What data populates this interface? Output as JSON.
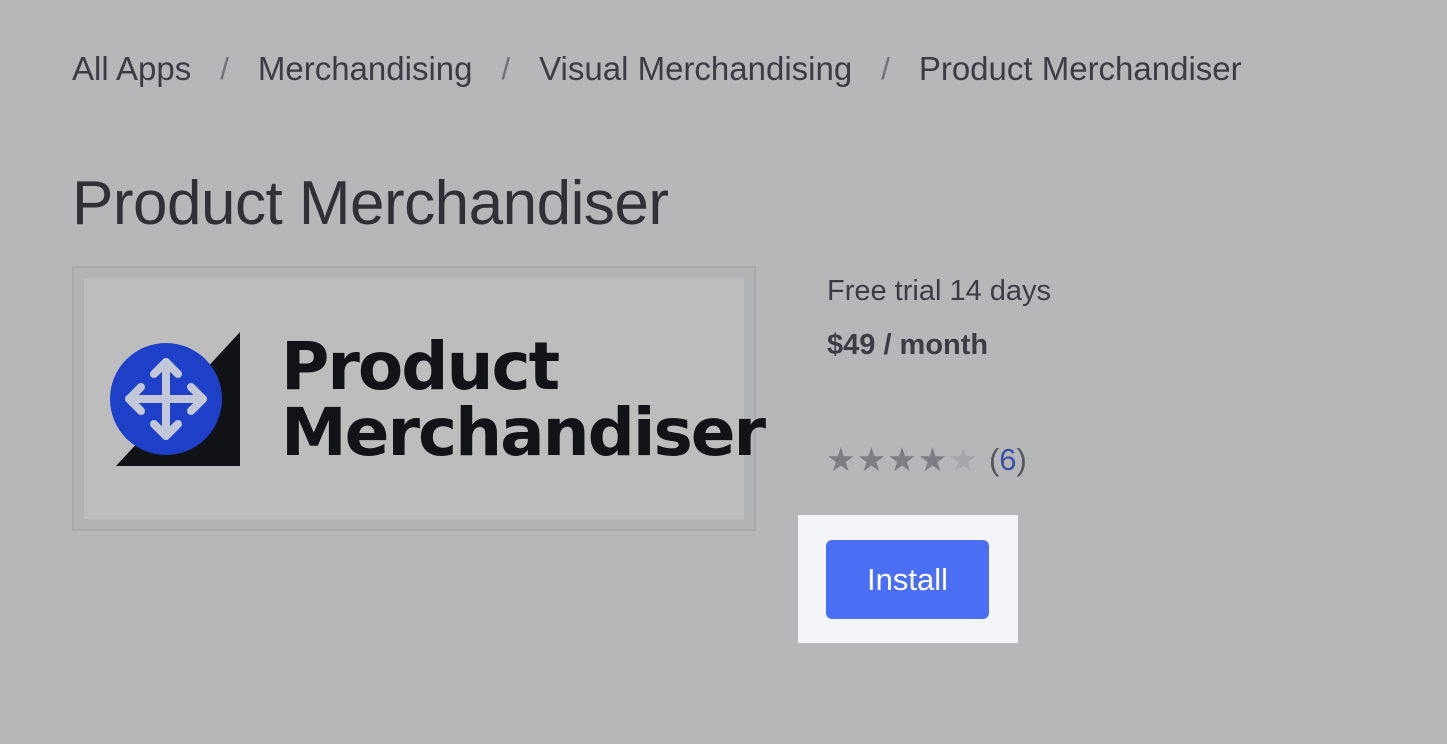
{
  "breadcrumb": {
    "items": [
      "All Apps",
      "Merchandising",
      "Visual Merchandising",
      "Product Merchandiser"
    ],
    "separator": "/"
  },
  "page_title": "Product Merchandiser",
  "logo": {
    "line1": "Product",
    "line2": "Merchandiser",
    "icon": "move-arrows-icon",
    "icon_color": "#1e40c8"
  },
  "pricing": {
    "trial": "Free trial 14 days",
    "price": "$49 / month"
  },
  "rating": {
    "stars_filled": 4,
    "stars_total": 5,
    "open_paren": "(",
    "count": "6",
    "close_paren": ")"
  },
  "install": {
    "label": "Install",
    "color": "#4a6ff5"
  }
}
